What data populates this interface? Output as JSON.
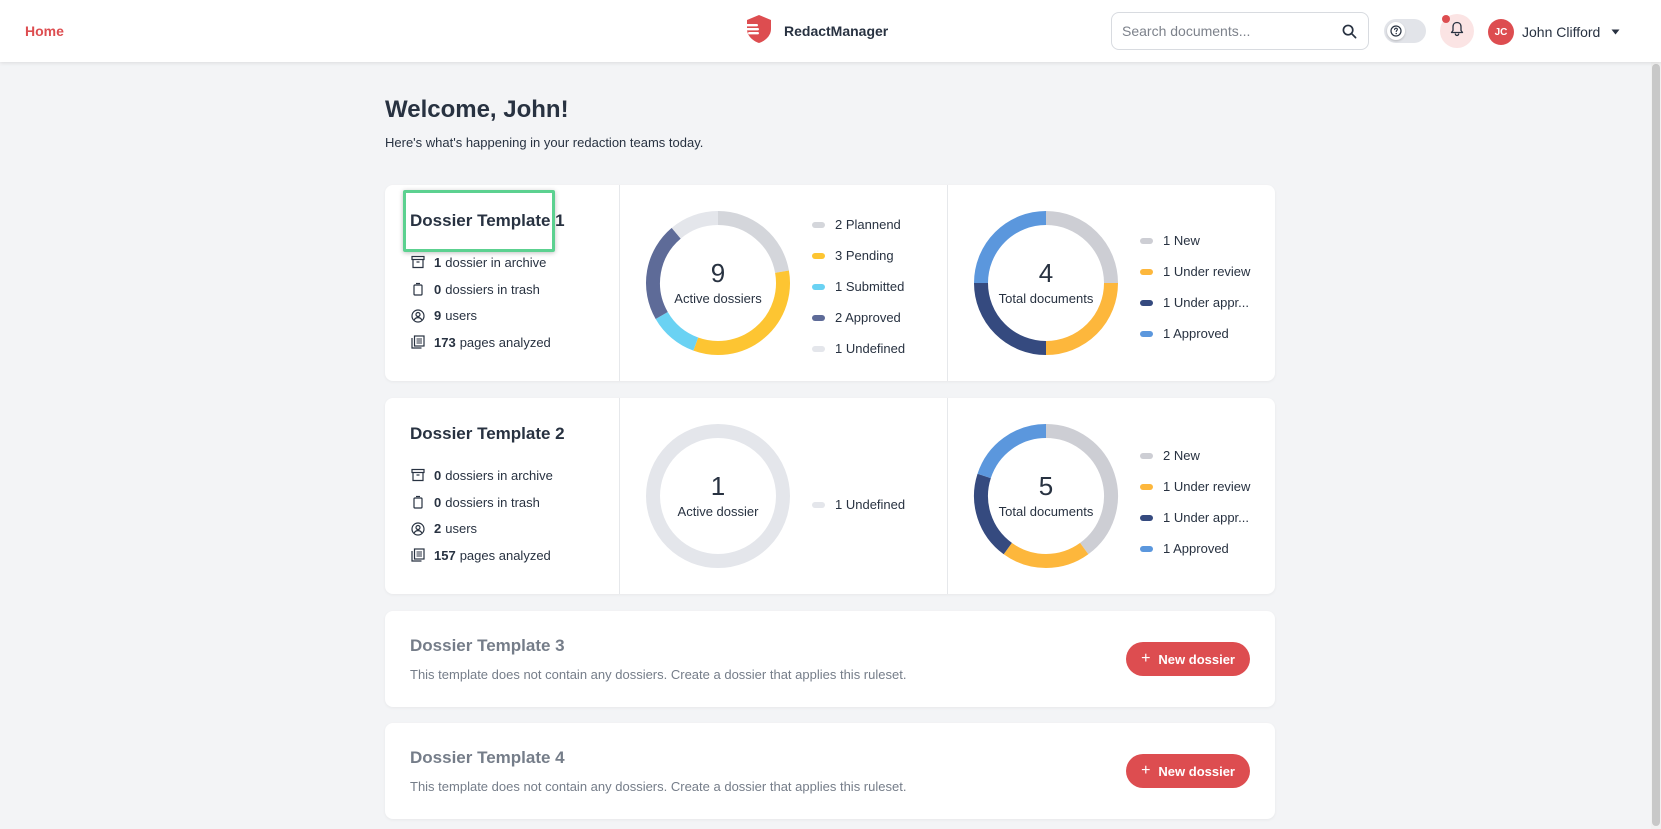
{
  "header": {
    "home_label": "Home",
    "brand_name": "RedactManager",
    "search_placeholder": "Search documents...",
    "user_initials": "JC",
    "user_name": "John Clifford"
  },
  "welcome": {
    "title": "Welcome, John!",
    "subtitle": "Here's what's happening in your redaction teams today."
  },
  "colors": {
    "accent": "#dd4d50",
    "planned": "#d4d6db",
    "pending": "#fdc532",
    "submitted": "#6ad2f3",
    "approved_dossier": "#5e6b98",
    "undefined": "#e4e6eb",
    "new": "#cdced4",
    "under_review": "#fdb73c",
    "under_approval": "#354a7f",
    "approved_doc": "#5b97dd"
  },
  "templates": [
    {
      "name": "Dossier Template 1",
      "stats": [
        {
          "icon": "archive-icon",
          "num": "1",
          "text": "dossier in archive"
        },
        {
          "icon": "trash-icon",
          "num": "0",
          "text": "dossiers in trash"
        },
        {
          "icon": "user-circle-icon",
          "num": "9",
          "text": "users"
        },
        {
          "icon": "pages-icon",
          "num": "173",
          "text": "pages analyzed"
        }
      ],
      "dossiers": {
        "total": "9",
        "label": "Active dossiers",
        "legend": [
          {
            "label": "2 Plannend",
            "value": 2,
            "color": "#d4d6db"
          },
          {
            "label": "3 Pending",
            "value": 3,
            "color": "#fdc532"
          },
          {
            "label": "1 Submitted",
            "value": 1,
            "color": "#6ad2f3"
          },
          {
            "label": "2 Approved",
            "value": 2,
            "color": "#5e6b98"
          },
          {
            "label": "1 Undefined",
            "value": 1,
            "color": "#e4e6eb"
          }
        ]
      },
      "documents": {
        "total": "4",
        "label": "Total documents",
        "legend": [
          {
            "label": "1 New",
            "value": 1,
            "color": "#cdced4"
          },
          {
            "label": "1 Under review",
            "value": 1,
            "color": "#fdb73c"
          },
          {
            "label": "1 Under appr...",
            "value": 1,
            "color": "#354a7f"
          },
          {
            "label": "1 Approved",
            "value": 1,
            "color": "#5b97dd"
          }
        ]
      }
    },
    {
      "name": "Dossier Template 2",
      "stats": [
        {
          "icon": "archive-icon",
          "num": "0",
          "text": "dossiers in archive"
        },
        {
          "icon": "trash-icon",
          "num": "0",
          "text": "dossiers in trash"
        },
        {
          "icon": "user-circle-icon",
          "num": "2",
          "text": "users"
        },
        {
          "icon": "pages-icon",
          "num": "157",
          "text": "pages analyzed"
        }
      ],
      "dossiers": {
        "total": "1",
        "label": "Active dossier",
        "legend": [
          {
            "label": "1 Undefined",
            "value": 1,
            "color": "#e4e6eb"
          }
        ]
      },
      "documents": {
        "total": "5",
        "label": "Total documents",
        "legend": [
          {
            "label": "2 New",
            "value": 2,
            "color": "#cdced4"
          },
          {
            "label": "1 Under review",
            "value": 1,
            "color": "#fdb73c"
          },
          {
            "label": "1 Under appr...",
            "value": 1,
            "color": "#354a7f"
          },
          {
            "label": "1 Approved",
            "value": 1,
            "color": "#5b97dd"
          }
        ]
      }
    }
  ],
  "empty_templates": [
    {
      "name": "Dossier Template 3",
      "description": "This template does not contain any dossiers. Create a dossier that applies this ruleset.",
      "button_label": "New dossier"
    },
    {
      "name": "Dossier Template 4",
      "description": "This template does not contain any dossiers. Create a dossier that applies this ruleset.",
      "button_label": "New dossier"
    }
  ]
}
